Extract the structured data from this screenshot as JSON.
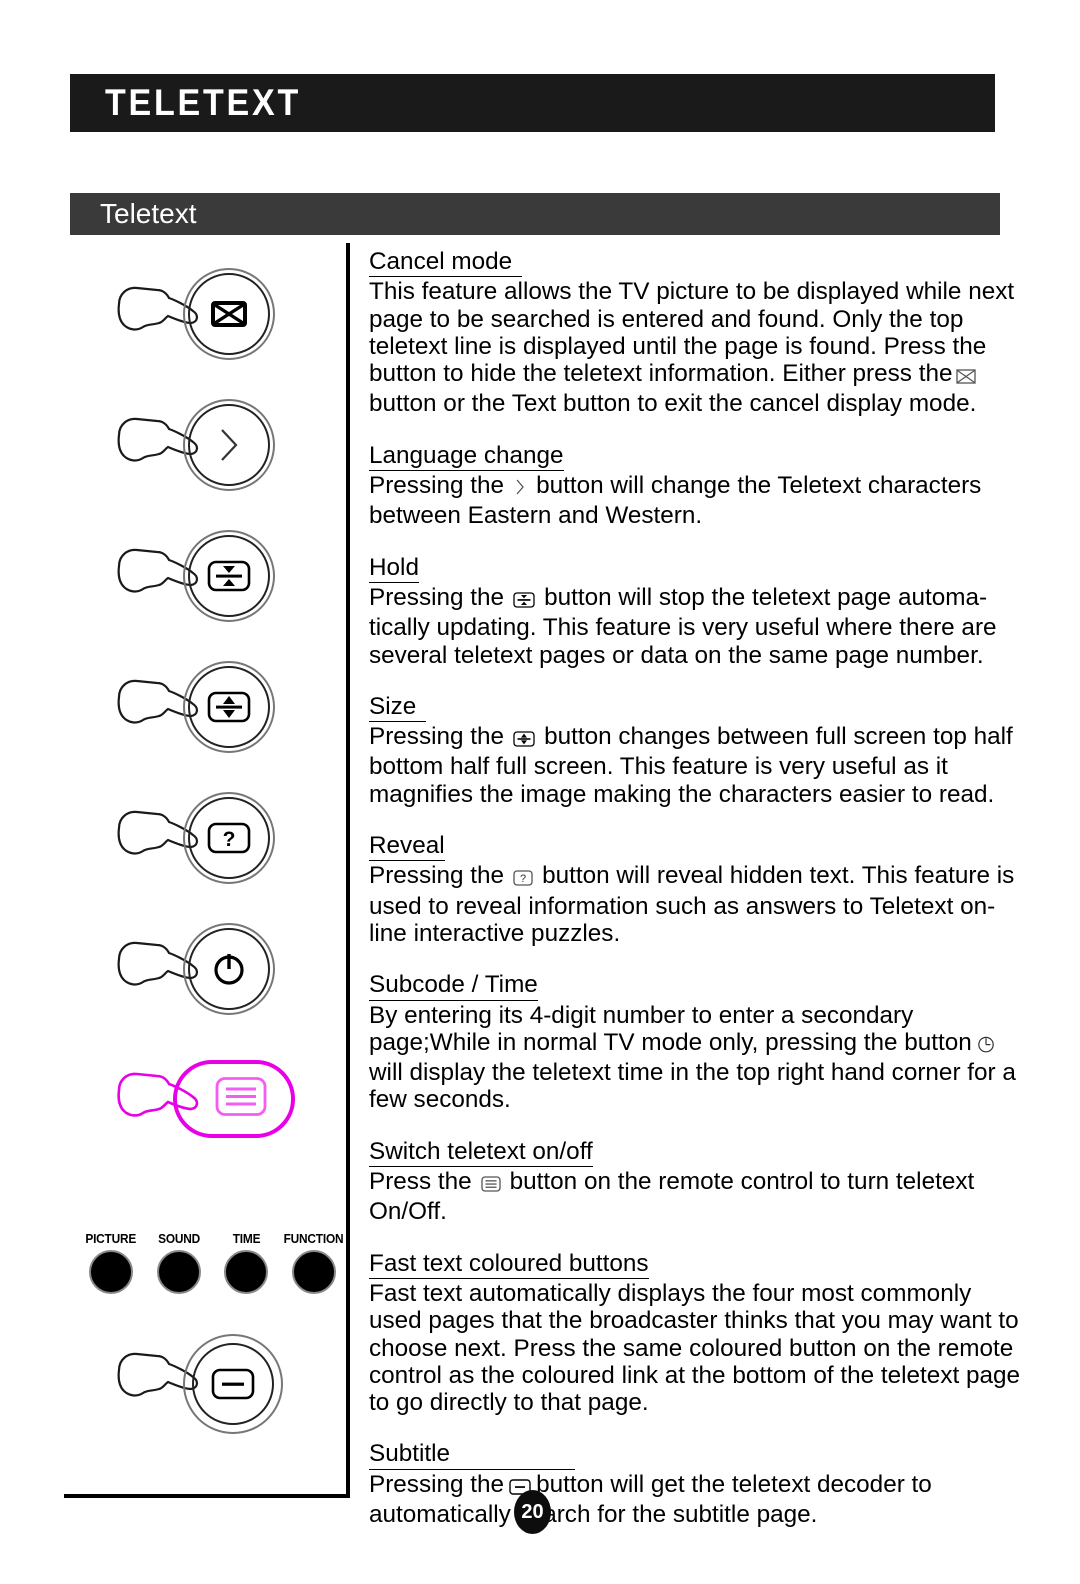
{
  "header": {
    "title": "TELETEXT"
  },
  "section": {
    "title": "Teletext"
  },
  "page": {
    "number": "20"
  },
  "colors": {
    "header_bg": "#1a1a1a",
    "section_bg": "#3a3a3a",
    "highlight": "#e800e8",
    "text": "#000000"
  },
  "illustrations": [
    {
      "name": "cancel-button",
      "icon": "crossed-envelope-icon",
      "shape": "circle",
      "highlighted": false
    },
    {
      "name": "language-change-button",
      "icon": "chevron-right-icon",
      "shape": "circle",
      "highlighted": false
    },
    {
      "name": "hold-button",
      "icon": "hold-icon",
      "shape": "circle",
      "highlighted": false
    },
    {
      "name": "size-button",
      "icon": "size-icon",
      "shape": "circle",
      "highlighted": false
    },
    {
      "name": "reveal-button",
      "icon": "question-mark-icon",
      "shape": "circle",
      "highlighted": false
    },
    {
      "name": "subcode-time-button",
      "icon": "power-clock-icon",
      "shape": "circle",
      "highlighted": false
    },
    {
      "name": "teletext-onoff-button",
      "icon": "teletext-lines-icon",
      "shape": "pill",
      "highlighted": true
    },
    {
      "name": "subtitle-button",
      "icon": "subtitle-bar-icon",
      "shape": "circle-double",
      "highlighted": false
    }
  ],
  "colour_buttons": [
    {
      "label": "PICTURE"
    },
    {
      "label": "SOUND"
    },
    {
      "label": "TIME"
    },
    {
      "label": "FUNCTION"
    }
  ],
  "sections": [
    {
      "heading": "Cancel mode",
      "text_1": "This feature allows the TV picture to be displayed while next page to be searched is entered and found. Only the top teletext line is displayed until the page is found. Press the button to hide the teletext information. Either press the",
      "icon": "crossed-envelope-icon",
      "text_2": "button or the Text button to exit the cancel display mode."
    },
    {
      "heading": "Language change",
      "text_1": "Pressing the",
      "icon": "chevron-right-icon",
      "text_2": "button will change the Teletext characters between Eastern and Western."
    },
    {
      "heading": "Hold",
      "text_1": "Pressing the",
      "icon": "hold-icon",
      "text_2": "button will stop the teletext page automa-tically updating. This feature is very useful where there are several teletext pages or data on the same page number."
    },
    {
      "heading": "Size",
      "text_1": "Pressing the",
      "icon": "size-icon",
      "text_2": "button changes between full screen  top half  bottom half  full screen. This feature is very useful as it magnifies the image making the characters easier to read."
    },
    {
      "heading": "Reveal",
      "text_1": "Pressing the",
      "icon": "question-mark-icon",
      "text_2": "button will reveal hidden text. This feature is used to reveal information such as answers to Teletext on-line interactive puzzles."
    },
    {
      "heading": "Subcode / Time",
      "text_1": "By entering its 4-digit number to enter a secondary page;While in normal TV mode only, pressing the button",
      "icon": "clock-icon",
      "text_2": "will display the teletext time in the top right hand corner for a few seconds."
    },
    {
      "heading": "Switch teletext on/off",
      "text_1": "Press the",
      "icon": "teletext-lines-icon",
      "text_2": "button on the remote control to turn teletext  On/Off."
    },
    {
      "heading": "Fast text coloured buttons",
      "text_1": "Fast text automatically displays the four most commonly used pages that the broadcaster thinks that you may want to choose next. Press the same coloured button on the remote control as the coloured link at the bottom of the teletext page to go directly to that page.",
      "icon": "",
      "text_2": ""
    },
    {
      "heading": "Subtitle",
      "text_1": "Pressing the",
      "icon": "subtitle-bar-icon",
      "text_2": "button will get the teletext decoder to automatically search for the subtitle page."
    }
  ]
}
